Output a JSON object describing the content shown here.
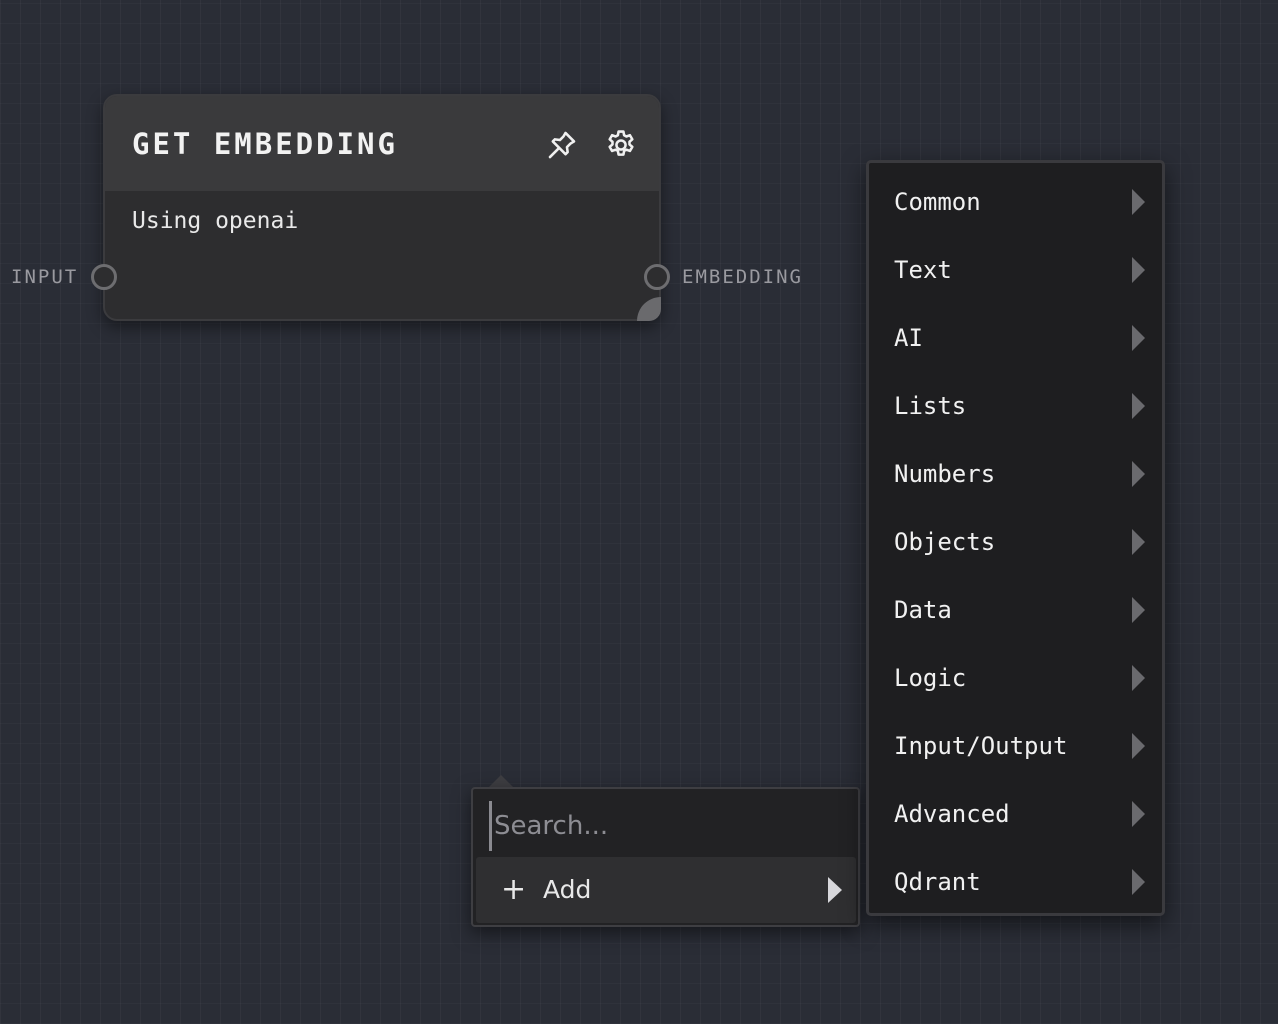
{
  "node": {
    "title": "GET EMBEDDING",
    "body_text": "Using openai",
    "input_port_label": "INPUT",
    "output_port_label": "EMBEDDING",
    "icons": [
      "pin-icon",
      "gear-icon"
    ]
  },
  "search": {
    "placeholder": "Search...",
    "value": "",
    "add_label": "Add",
    "add_icon": "plus"
  },
  "menu": {
    "items": [
      {
        "label": "Common"
      },
      {
        "label": "Text"
      },
      {
        "label": "AI"
      },
      {
        "label": "Lists"
      },
      {
        "label": "Numbers"
      },
      {
        "label": "Objects"
      },
      {
        "label": "Data"
      },
      {
        "label": "Logic"
      },
      {
        "label": "Input/Output"
      },
      {
        "label": "Advanced"
      },
      {
        "label": "Qdrant"
      }
    ]
  },
  "colors": {
    "canvas_bg": "#2a2d36",
    "node_bg": "#2d2d2f",
    "node_header_bg": "#3a3a3c",
    "menu_bg": "#1e1e20",
    "text": "#f1f1f1",
    "muted_text": "#9a9aa0"
  }
}
